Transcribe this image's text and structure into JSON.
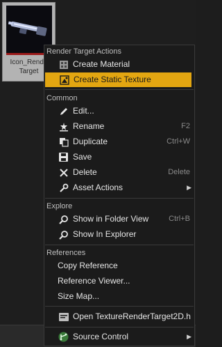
{
  "asset": {
    "name_line1": "Icon_Rende",
    "name_line2": "Target"
  },
  "menu": {
    "sections": {
      "render_target": "Render Target Actions",
      "common": "Common",
      "explore": "Explore",
      "references": "References"
    },
    "items": {
      "create_material": {
        "label": "Create Material",
        "icon": "material-icon"
      },
      "create_static_texture": {
        "label": "Create Static Texture",
        "icon": "static-texture-icon"
      },
      "edit": {
        "label": "Edit...",
        "icon": "edit-icon"
      },
      "rename": {
        "label": "Rename",
        "shortcut": "F2",
        "icon": "rename-icon"
      },
      "duplicate": {
        "label": "Duplicate",
        "shortcut": "Ctrl+W",
        "icon": "duplicate-icon"
      },
      "save": {
        "label": "Save",
        "icon": "save-icon"
      },
      "delete": {
        "label": "Delete",
        "shortcut": "Delete",
        "icon": "delete-icon"
      },
      "asset_actions": {
        "label": "Asset Actions",
        "icon": "wrench-icon"
      },
      "show_in_folder": {
        "label": "Show in Folder View",
        "shortcut": "Ctrl+B",
        "icon": "magnify-icon"
      },
      "show_in_explorer": {
        "label": "Show In Explorer",
        "icon": "magnify-icon"
      },
      "copy_reference": {
        "label": "Copy Reference"
      },
      "reference_viewer": {
        "label": "Reference Viewer..."
      },
      "size_map": {
        "label": "Size Map..."
      },
      "open_header": {
        "label": "Open TextureRenderTarget2D.h",
        "icon": "header-file-icon"
      },
      "source_control": {
        "label": "Source Control",
        "icon": "source-control-icon"
      }
    },
    "highlight_color": "#e3a611"
  }
}
